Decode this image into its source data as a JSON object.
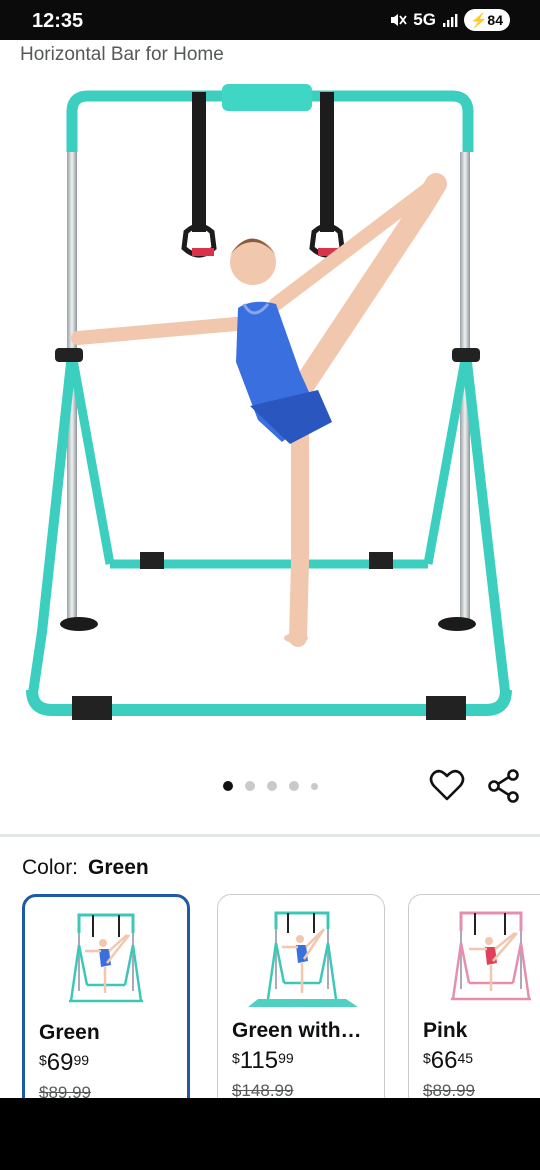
{
  "status_bar": {
    "time": "12:35",
    "network": "5G",
    "battery": "84"
  },
  "product": {
    "title": "Horizontal Bar for Home"
  },
  "carousel": {
    "dot_count": 5,
    "active_index": 0
  },
  "color_selector": {
    "label": "Color:",
    "selected": "Green"
  },
  "variants": [
    {
      "name": "Green",
      "currency": "$",
      "whole": "69",
      "fraction": "99",
      "list_price": "$89.99",
      "selected": true,
      "frame_color": "#3cc8b8"
    },
    {
      "name": "Green with…",
      "currency": "$",
      "whole": "115",
      "fraction": "99",
      "list_price": "$148.99",
      "selected": false,
      "frame_color": "#3cc8b8"
    },
    {
      "name": "Pink",
      "currency": "$",
      "whole": "66",
      "fraction": "45",
      "list_price": "$89.99",
      "selected": false,
      "frame_color": "#e58fb0"
    }
  ],
  "colors": {
    "frame": "#3ccfc0",
    "selected_border": "#1f5aa6",
    "leotard": "#3a6fe0"
  }
}
